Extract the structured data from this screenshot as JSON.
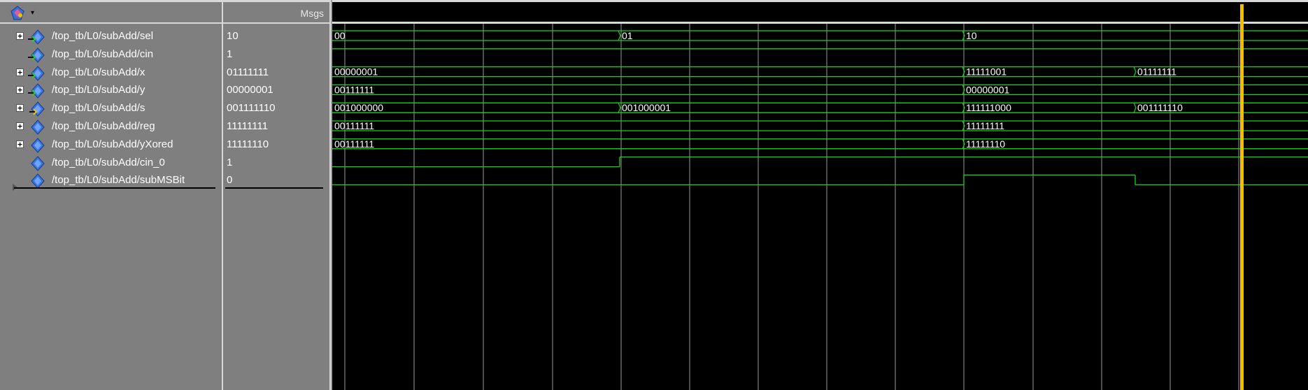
{
  "toolbar": {
    "icon": "wave-tool-icon",
    "dropdown_glyph": "▾"
  },
  "header": {
    "msgs_label": "Msgs"
  },
  "colors": {
    "wave": "#18d418",
    "cursor": "#f0c000",
    "grid": "#9a9a9a",
    "background": "#000000",
    "panel": "#7f7f7f"
  },
  "signals": [
    {
      "name": "/top_tb/L0/subAdd/sel",
      "value": "10",
      "expandable": true,
      "icon": "input-port-icon"
    },
    {
      "name": "/top_tb/L0/subAdd/cin",
      "value": "1",
      "expandable": false,
      "icon": "input-port-icon"
    },
    {
      "name": "/top_tb/L0/subAdd/x",
      "value": "01111111",
      "expandable": true,
      "icon": "input-port-icon"
    },
    {
      "name": "/top_tb/L0/subAdd/y",
      "value": "00000001",
      "expandable": true,
      "icon": "input-port-icon"
    },
    {
      "name": "/top_tb/L0/subAdd/s",
      "value": "001111110",
      "expandable": true,
      "icon": "output-port-icon"
    },
    {
      "name": "/top_tb/L0/subAdd/reg",
      "value": "11111111",
      "expandable": true,
      "icon": "signal-icon"
    },
    {
      "name": "/top_tb/L0/subAdd/yXored",
      "value": "11111110",
      "expandable": true,
      "icon": "signal-icon"
    },
    {
      "name": "/top_tb/L0/subAdd/cin_0",
      "value": "1",
      "expandable": false,
      "icon": "signal-icon"
    },
    {
      "name": "/top_tb/L0/subAdd/subMSBit",
      "value": "0",
      "expandable": false,
      "icon": "signal-icon"
    }
  ],
  "waves": [
    {
      "signal": "sel",
      "kind": "bus",
      "segments": [
        {
          "label": "00"
        },
        {
          "label": "01"
        },
        {
          "label": "10"
        }
      ]
    },
    {
      "signal": "cin",
      "kind": "bit",
      "levels": [
        1
      ]
    },
    {
      "signal": "x",
      "kind": "bus",
      "segments": [
        {
          "label": "00000001"
        },
        {
          "label": "11111001"
        },
        {
          "label": "01111111"
        }
      ]
    },
    {
      "signal": "y",
      "kind": "bus",
      "segments": [
        {
          "label": "00111111"
        },
        {
          "label": "00000001"
        }
      ]
    },
    {
      "signal": "s",
      "kind": "bus",
      "segments": [
        {
          "label": "001000000"
        },
        {
          "label": "001000001"
        },
        {
          "label": "111111000"
        },
        {
          "label": "001111110"
        }
      ]
    },
    {
      "signal": "reg",
      "kind": "bus",
      "segments": [
        {
          "label": "00111111"
        },
        {
          "label": "11111111"
        }
      ]
    },
    {
      "signal": "yXored",
      "kind": "bus",
      "segments": [
        {
          "label": "00111111"
        },
        {
          "label": "11111110"
        }
      ]
    },
    {
      "signal": "cin_0",
      "kind": "bit",
      "levels": [
        0,
        1
      ]
    },
    {
      "signal": "subMSBit",
      "kind": "bit",
      "levels": [
        0,
        1,
        0
      ]
    }
  ]
}
